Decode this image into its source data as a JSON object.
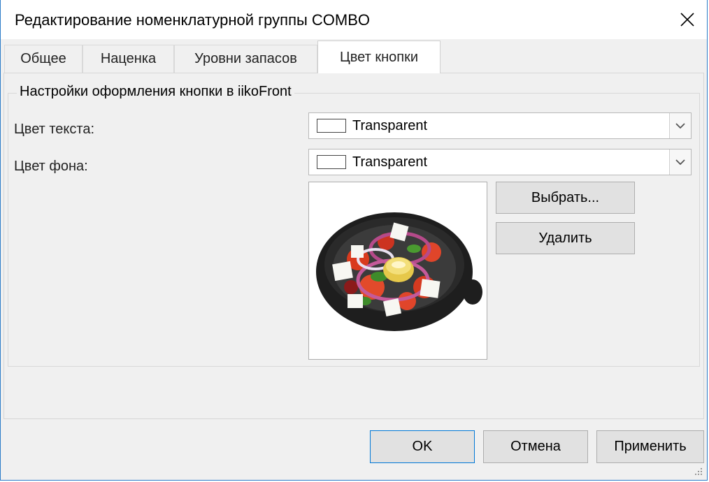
{
  "window": {
    "title": "Редактирование номенклатурной группы COMBO"
  },
  "tabs": [
    {
      "label": "Общее",
      "active": false
    },
    {
      "label": "Наценка",
      "active": false
    },
    {
      "label": "Уровни запасов",
      "active": false
    },
    {
      "label": "Цвет кнопки",
      "active": true
    }
  ],
  "group": {
    "legend": "Настройки оформления кнопки в iikoFront",
    "text_color": {
      "label": "Цвет текста:",
      "value": "Transparent"
    },
    "bg_color": {
      "label": "Цвет фона:",
      "value": "Transparent"
    },
    "choose_button": "Выбрать...",
    "delete_button": "Удалить"
  },
  "footer": {
    "ok_button": "OK",
    "cancel_button": "Отмена",
    "apply_button": "Применить"
  },
  "colors": {
    "window_border": "#2b7bc8",
    "default_button_border": "#0078d7",
    "dialog_bg": "#f0f0f0"
  },
  "icons": [
    "close-icon",
    "chevron-down-icon",
    "salad-bowl-image",
    "resize-grip-icon"
  ]
}
